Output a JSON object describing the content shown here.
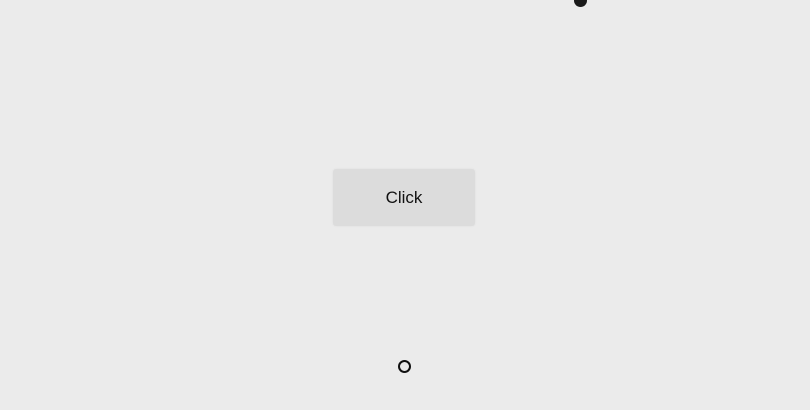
{
  "button": {
    "label": "Click"
  },
  "icons": {
    "top_dot": "filled-circle-icon",
    "cursor": "cursor-ring-icon"
  },
  "colors": {
    "background": "#ebebeb",
    "button_bg": "#dcdcdc",
    "text": "#111111",
    "dot": "#1a1a1a"
  }
}
